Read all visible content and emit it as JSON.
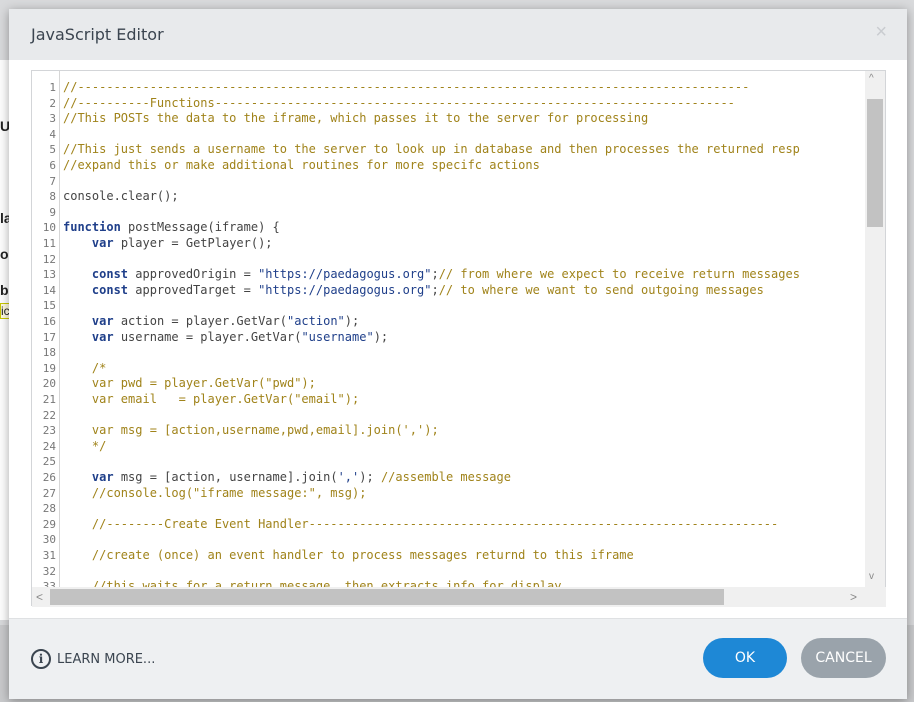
{
  "dialog": {
    "title": "JavaScript Editor",
    "close_icon": "×"
  },
  "editor": {
    "lines": [
      {
        "n": "1",
        "parts": [
          {
            "c": "cm",
            "t": "//---------------------------------------------------------------------------------------------"
          }
        ]
      },
      {
        "n": "2",
        "parts": [
          {
            "c": "cm",
            "t": "//----------Functions------------------------------------------------------------------------"
          }
        ]
      },
      {
        "n": "3",
        "parts": [
          {
            "c": "cm",
            "t": "//This POSTs the data to the iframe, which passes it to the server for processing"
          }
        ]
      },
      {
        "n": "4",
        "parts": []
      },
      {
        "n": "5",
        "parts": [
          {
            "c": "cm",
            "t": "//This just sends a username to the server to look up in database and then processes the returned resp"
          }
        ]
      },
      {
        "n": "6",
        "parts": [
          {
            "c": "cm",
            "t": "//expand this or make additional routines for more specifc actions"
          }
        ]
      },
      {
        "n": "7",
        "parts": []
      },
      {
        "n": "8",
        "parts": [
          {
            "c": "",
            "t": "console.clear();"
          }
        ]
      },
      {
        "n": "9",
        "parts": []
      },
      {
        "n": "10",
        "parts": [
          {
            "c": "kw",
            "t": "function"
          },
          {
            "c": "",
            "t": " postMessage(iframe) {"
          }
        ]
      },
      {
        "n": "11",
        "parts": [
          {
            "c": "",
            "t": "    "
          },
          {
            "c": "kw",
            "t": "var"
          },
          {
            "c": "",
            "t": " player = GetPlayer();"
          }
        ]
      },
      {
        "n": "12",
        "parts": []
      },
      {
        "n": "13",
        "parts": [
          {
            "c": "",
            "t": "    "
          },
          {
            "c": "kw",
            "t": "const"
          },
          {
            "c": "",
            "t": " approvedOrigin = "
          },
          {
            "c": "str",
            "t": "\"https://paedagogus.org\""
          },
          {
            "c": "",
            "t": ";"
          },
          {
            "c": "cm",
            "t": "// from where we expect to receive return messages"
          }
        ]
      },
      {
        "n": "14",
        "parts": [
          {
            "c": "",
            "t": "    "
          },
          {
            "c": "kw",
            "t": "const"
          },
          {
            "c": "",
            "t": " approvedTarget = "
          },
          {
            "c": "str",
            "t": "\"https://paedagogus.org\""
          },
          {
            "c": "",
            "t": ";"
          },
          {
            "c": "cm",
            "t": "// to where we want to send outgoing messages"
          }
        ]
      },
      {
        "n": "15",
        "parts": []
      },
      {
        "n": "16",
        "parts": [
          {
            "c": "",
            "t": "    "
          },
          {
            "c": "kw",
            "t": "var"
          },
          {
            "c": "",
            "t": " action = player.GetVar("
          },
          {
            "c": "str",
            "t": "\"action\""
          },
          {
            "c": "",
            "t": ");"
          }
        ]
      },
      {
        "n": "17",
        "parts": [
          {
            "c": "",
            "t": "    "
          },
          {
            "c": "kw",
            "t": "var"
          },
          {
            "c": "",
            "t": " username = player.GetVar("
          },
          {
            "c": "str",
            "t": "\"username\""
          },
          {
            "c": "",
            "t": ");"
          }
        ]
      },
      {
        "n": "18",
        "parts": []
      },
      {
        "n": "19",
        "parts": [
          {
            "c": "cm",
            "t": "    /*"
          }
        ]
      },
      {
        "n": "20",
        "parts": [
          {
            "c": "cm",
            "t": "    var pwd = player.GetVar(\"pwd\");"
          }
        ]
      },
      {
        "n": "21",
        "parts": [
          {
            "c": "cm",
            "t": "    var email   = player.GetVar(\"email\");"
          }
        ]
      },
      {
        "n": "22",
        "parts": []
      },
      {
        "n": "23",
        "parts": [
          {
            "c": "cm",
            "t": "    var msg = [action,username,pwd,email].join(',');"
          }
        ]
      },
      {
        "n": "24",
        "parts": [
          {
            "c": "cm",
            "t": "    */"
          }
        ]
      },
      {
        "n": "25",
        "parts": []
      },
      {
        "n": "26",
        "parts": [
          {
            "c": "",
            "t": "    "
          },
          {
            "c": "kw",
            "t": "var"
          },
          {
            "c": "",
            "t": " msg = [action, username].join("
          },
          {
            "c": "str",
            "t": "','"
          },
          {
            "c": "",
            "t": "); "
          },
          {
            "c": "cm",
            "t": "//assemble message"
          }
        ]
      },
      {
        "n": "27",
        "parts": [
          {
            "c": "cm",
            "t": "    //console.log(\"iframe message:\", msg);"
          }
        ]
      },
      {
        "n": "28",
        "parts": []
      },
      {
        "n": "29",
        "parts": [
          {
            "c": "cm",
            "t": "    //--------Create Event Handler-----------------------------------------------------------------"
          }
        ]
      },
      {
        "n": "30",
        "parts": []
      },
      {
        "n": "31",
        "parts": [
          {
            "c": "cm",
            "t": "    //create (once) an event handler to process messages returnd to this iframe"
          }
        ]
      },
      {
        "n": "32",
        "parts": []
      },
      {
        "n": "33",
        "parts": [
          {
            "c": "cm",
            "t": "    //this waits for a return message, then extracts info for display"
          }
        ]
      }
    ]
  },
  "footer": {
    "learn_more_label": "LEARN MORE...",
    "info_icon": "i",
    "ok_label": "OK",
    "cancel_label": "CANCEL"
  },
  "scroll": {
    "up_arrow": "^",
    "down_arrow": "v",
    "left_arrow": "<",
    "right_arrow": ">"
  },
  "background": {
    "fragments": [
      "U",
      "la",
      "o",
      "b",
      "ic"
    ]
  }
}
